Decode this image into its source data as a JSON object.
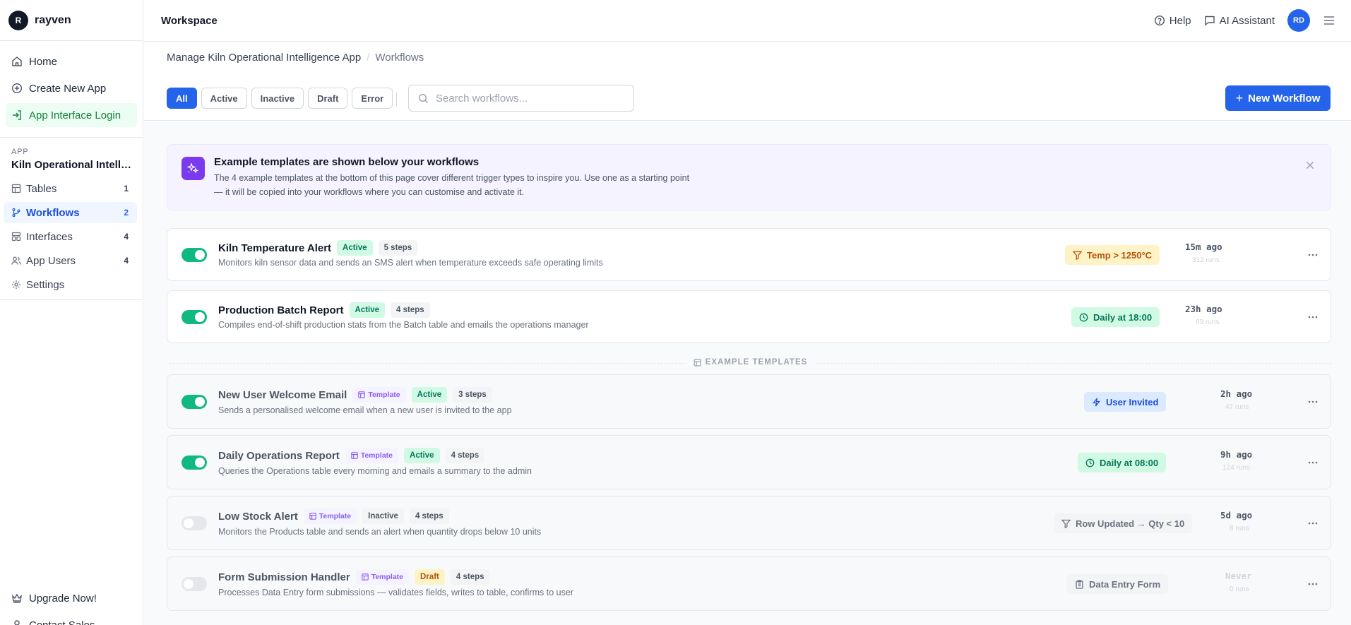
{
  "brand": {
    "logo_letter": "R",
    "name": "rayven"
  },
  "sidebar": {
    "top_items": [
      {
        "label": "Home"
      },
      {
        "label": "Create New App"
      },
      {
        "label": "App Interface Login"
      }
    ],
    "app_label": "APP",
    "app_name": "Kiln Operational Intelligence App",
    "sub_items": [
      {
        "label": "Tables",
        "count": "1"
      },
      {
        "label": "Workflows",
        "count": "2"
      },
      {
        "label": "Interfaces",
        "count": "4"
      },
      {
        "label": "App Users",
        "count": "4"
      },
      {
        "label": "Settings"
      }
    ],
    "bottom_items": [
      {
        "label": "Upgrade Now!"
      },
      {
        "label": "Contact Sales"
      }
    ]
  },
  "topbar": {
    "title": "Workspace",
    "help": "Help",
    "assistant": "AI Assistant",
    "avatar_initials": "RD"
  },
  "breadcrumb": {
    "parent": "Manage Kiln Operational Intelligence App",
    "separator": "/",
    "current": "Workflows"
  },
  "filters": {
    "buttons": [
      {
        "label": "All"
      },
      {
        "label": "Active"
      },
      {
        "label": "Inactive"
      },
      {
        "label": "Draft"
      },
      {
        "label": "Error"
      }
    ],
    "selected": "All",
    "search_placeholder": "Search workflows...",
    "new_button": "New Workflow"
  },
  "banner": {
    "title": "Example templates are shown below your workflows",
    "text": "The 4 example templates at the bottom of this page cover different trigger types to inspire you. Use one as a starting point — it will be copied into your workflows where you can customise and activate it."
  },
  "divider_label": "EXAMPLE TEMPLATES",
  "workflows": [
    {
      "name": "Kiln Temperature Alert",
      "status": "Active",
      "steps": "5 steps",
      "description": "Monitors kiln sensor data and sends an SMS alert when temperature exceeds safe operating limits",
      "trigger": "Temp > 1250°C",
      "time": "15m ago",
      "runs": "312 runs",
      "enabled": true
    },
    {
      "name": "Production Batch Report",
      "status": "Active",
      "steps": "4 steps",
      "description": "Compiles end-of-shift production stats from the Batch table and emails the operations manager",
      "trigger": "Daily at 18:00",
      "time": "23h ago",
      "runs": "63 runs",
      "enabled": true
    }
  ],
  "templates": [
    {
      "name": "New User Welcome Email",
      "tag": "Template",
      "status": "Active",
      "steps": "3 steps",
      "description": "Sends a personalised welcome email when a new user is invited to the app",
      "trigger": "User Invited",
      "time": "2h ago",
      "runs": "47 runs",
      "enabled": true
    },
    {
      "name": "Daily Operations Report",
      "tag": "Template",
      "status": "Active",
      "steps": "4 steps",
      "description": "Queries the Operations table every morning and emails a summary to the admin",
      "trigger": "Daily at 08:00",
      "time": "9h ago",
      "runs": "124 runs",
      "enabled": true
    },
    {
      "name": "Low Stock Alert",
      "tag": "Template",
      "status": "Inactive",
      "steps": "4 steps",
      "description": "Monitors the Products table and sends an alert when quantity drops below 10 units",
      "trigger": "Row Updated → Qty < 10",
      "time": "5d ago",
      "runs": "8 runs",
      "enabled": false
    },
    {
      "name": "Form Submission Handler",
      "tag": "Template",
      "status": "Draft",
      "steps": "4 steps",
      "description": "Processes Data Entry form submissions — validates fields, writes to table, confirms to user",
      "trigger": "Data Entry Form",
      "time": "Never",
      "runs": "0 runs",
      "enabled": false
    }
  ]
}
